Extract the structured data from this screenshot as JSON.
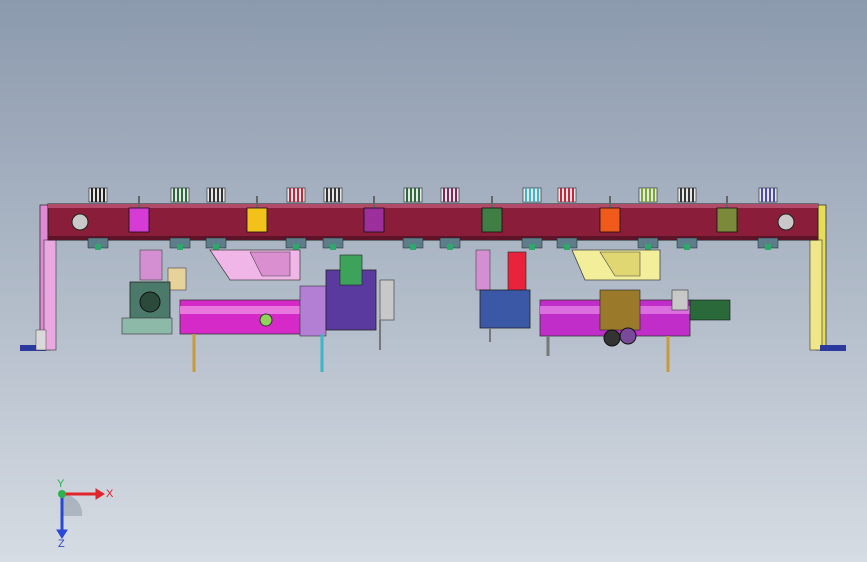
{
  "viewport": {
    "background_top": "#8c9aae",
    "background_bottom": "#d6dce3"
  },
  "triad": {
    "x_label": "X",
    "y_label": "Y",
    "z_label": "Z",
    "x_color": "#e0242a",
    "y_color": "#2bb24c",
    "z_color": "#2b47d6"
  },
  "model": {
    "beam_color": "#8a1e3a",
    "column_left_color": "#e08ad6",
    "column_right_color": "#e6dd55",
    "tool_colors": [
      "#d63bd6",
      "#f2c21a",
      "#9c2f9c",
      "#3f7f46",
      "#f05a1a",
      "#7a8a3a"
    ]
  }
}
